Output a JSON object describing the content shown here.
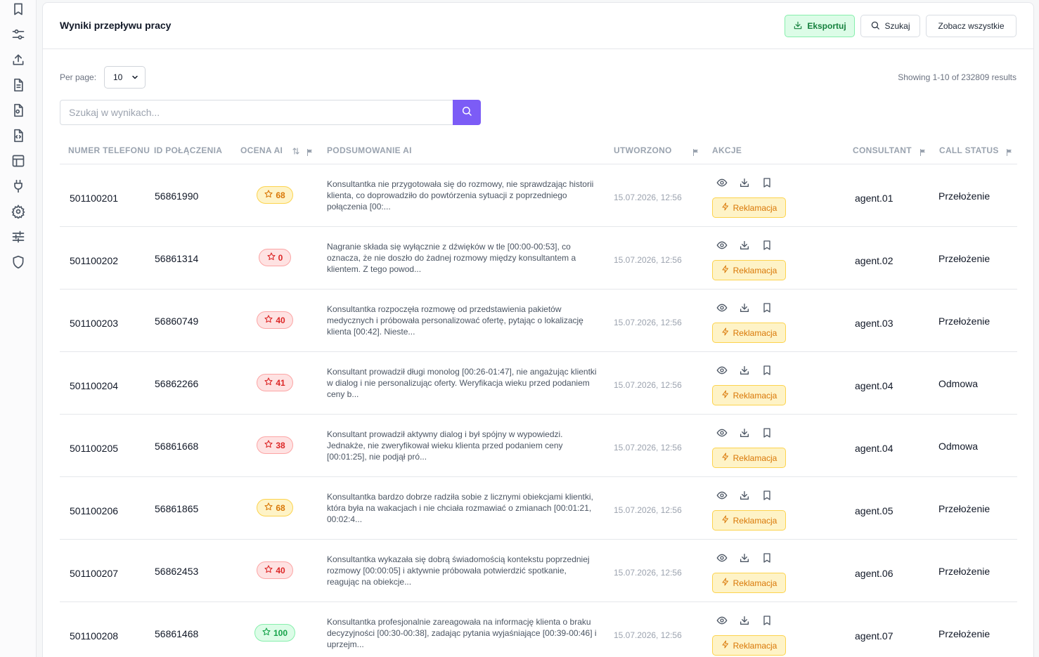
{
  "sidebar": {
    "icons": [
      "bookmark-icon",
      "sliders-icon",
      "upload-icon",
      "document-icon",
      "file-settings-icon",
      "file-code-icon",
      "table-icon",
      "plug-icon",
      "gear-icon",
      "tune-icon",
      "shield-icon"
    ]
  },
  "header": {
    "title": "Wyniki przepływu pracy",
    "export_label": "Eksportuj",
    "search_label": "Szukaj",
    "view_all_label": "Zobacz wszystkie"
  },
  "controls": {
    "per_page_label": "Per page:",
    "per_page_value": "10",
    "showing_text": "Showing 1-10 of 232809 results",
    "search_placeholder": "Szukaj w wynikach..."
  },
  "table": {
    "columns": {
      "phone": "NUMER TELEFONU",
      "call_id": "ID POŁĄCZENIA",
      "ai_score": "OCENA AI",
      "ai_summary": "PODSUMOWANIE AI",
      "created": "UTWORZONO",
      "actions": "AKCJE",
      "consultant": "CONSULTANT",
      "call_status": "CALL STATUS"
    },
    "complaint_label": "Reklamacja",
    "rows": [
      {
        "phone": "501100201",
        "call_id": "56861990",
        "score": "68",
        "score_color": "yellow",
        "summary": "Konsultantka nie przygotowała się do rozmowy, nie sprawdzając historii klienta, co doprowadziło do powtórzenia sytuacji z poprzedniego połączenia [00:...",
        "created": "15.07.2026, 12:56",
        "consultant": "agent.01",
        "status": "Przełożenie"
      },
      {
        "phone": "501100202",
        "call_id": "56861314",
        "score": "0",
        "score_color": "red",
        "summary": "Nagranie składa się wyłącznie z dźwięków w tle [00:00-00:53], co oznacza, że nie doszło do żadnej rozmowy między konsultantem a klientem. Z tego powod...",
        "created": "15.07.2026, 12:56",
        "consultant": "agent.02",
        "status": "Przełożenie"
      },
      {
        "phone": "501100203",
        "call_id": "56860749",
        "score": "40",
        "score_color": "red",
        "summary": "Konsultantka rozpoczęła rozmowę od przedstawienia pakietów medycznych i próbowała personalizować ofertę, pytając o lokalizację klienta [00:42]. Nieste...",
        "created": "15.07.2026, 12:56",
        "consultant": "agent.03",
        "status": "Przełożenie"
      },
      {
        "phone": "501100204",
        "call_id": "56862266",
        "score": "41",
        "score_color": "red",
        "summary": "Konsultant prowadził długi monolog [00:26-01:47], nie angażując klientki w dialog i nie personalizując oferty. Weryfikacja wieku przed podaniem ceny b...",
        "created": "15.07.2026, 12:56",
        "consultant": "agent.04",
        "status": "Odmowa"
      },
      {
        "phone": "501100205",
        "call_id": "56861668",
        "score": "38",
        "score_color": "red",
        "summary": "Konsultant prowadził aktywny dialog i był spójny w wypowiedzi. Jednakże, nie zweryfikował wieku klienta przed podaniem ceny [00:01:25], nie podjął pró...",
        "created": "15.07.2026, 12:56",
        "consultant": "agent.04",
        "status": "Odmowa"
      },
      {
        "phone": "501100206",
        "call_id": "56861865",
        "score": "68",
        "score_color": "yellow",
        "summary": "Konsultantka bardzo dobrze radziła sobie z licznymi obiekcjami klientki, która była na wakacjach i nie chciała rozmawiać o zmianach [00:01:21, 00:02:4...",
        "created": "15.07.2026, 12:56",
        "consultant": "agent.05",
        "status": "Przełożenie"
      },
      {
        "phone": "501100207",
        "call_id": "56862453",
        "score": "40",
        "score_color": "red",
        "summary": "Konsultantka wykazała się dobrą świadomością kontekstu poprzedniej rozmowy [00:00:05] i aktywnie próbowała potwierdzić spotkanie, reagując na obiekcje...",
        "created": "15.07.2026, 12:56",
        "consultant": "agent.06",
        "status": "Przełożenie"
      },
      {
        "phone": "501100208",
        "call_id": "56861468",
        "score": "100",
        "score_color": "green",
        "summary": "Konsultantka profesjonalnie zareagowała na informację klienta o braku decyzyjności [00:30-00:38], zadając pytania wyjaśniające [00:39-00:46] i uprzejm...",
        "created": "15.07.2026, 12:56",
        "consultant": "agent.07",
        "status": "Przełożenie"
      }
    ]
  }
}
